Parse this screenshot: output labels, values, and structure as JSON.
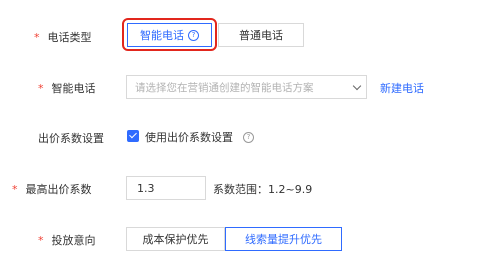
{
  "form": {
    "call_type": {
      "label": "电话类型",
      "options": [
        "智能电话",
        "普通电话"
      ],
      "selected": "智能电话"
    },
    "smart_call": {
      "label": "智能电话",
      "placeholder": "请选择您在营销通创建的智能电话方案",
      "new_link": "新建电话"
    },
    "bid_coef": {
      "label": "出价系数设置",
      "checkbox_label": "使用出价系数设置",
      "checked": true
    },
    "max_bid": {
      "label": "最高出价系数",
      "value": "1.3",
      "range_text": "系数范围：1.2~9.9"
    },
    "intent": {
      "label": "投放意向",
      "options": [
        "成本保护优先",
        "线索量提升优先"
      ],
      "selected": "线索量提升优先"
    }
  },
  "colors": {
    "accent": "#2f6bff",
    "required": "#f04134",
    "highlight_box": "#e2261d"
  },
  "icons": {
    "help": "question-circle-icon",
    "dropdown": "chevron-down-icon",
    "check": "checkmark-icon"
  }
}
